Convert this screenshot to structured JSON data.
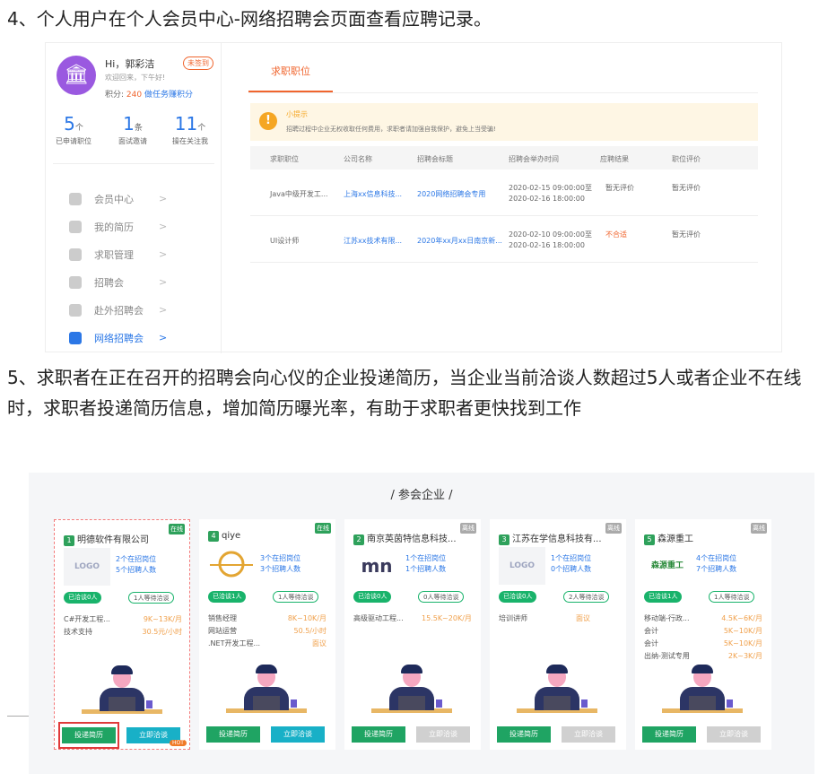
{
  "step4_text": "4、个人用户在个人会员中心-网络招聘会页面查看应聘记录。",
  "step5_text": "5、求职者在正在召开的招聘会向心仪的企业投递简历，当企业当前洽谈人数超过5人或者企业不在线时，求职者投递简历信息，增加简历曝光率，有助于求职者更快找到工作",
  "member": {
    "greeting": "Hi，郭彩洁",
    "sign_label": "未签到",
    "welcome": "欢迎回来，下午好!",
    "points_label": "积分:",
    "points_value": "240",
    "earn_link": "做任务赚积分",
    "stats": [
      {
        "num": "5",
        "unit": "个",
        "label": "已申请职位"
      },
      {
        "num": "1",
        "unit": "条",
        "label": "面试邀请"
      },
      {
        "num": "11",
        "unit": "个",
        "label": "操在关注我"
      }
    ],
    "menu": [
      {
        "label": "会员中心",
        "active": false
      },
      {
        "label": "我的简历",
        "active": false
      },
      {
        "label": "求职管理",
        "active": false
      },
      {
        "label": "招聘会",
        "active": false
      },
      {
        "label": "赴外招聘会",
        "active": false
      },
      {
        "label": "网络招聘会",
        "active": true
      }
    ]
  },
  "tab_label": "求职职位",
  "tip": {
    "title": "小提示",
    "text": "招聘过程中企业无权收取任何费用，求职者请加强自我保护，避免上当受骗!"
  },
  "table": {
    "headers": [
      "求职职位",
      "公司名称",
      "招聘会标题",
      "招聘会举办时间",
      "应聘结果",
      "职位评价"
    ],
    "rows": [
      {
        "position": "Java中级开发工...",
        "company": "上海xx信息科技...",
        "fair": "2020网络招聘会专用",
        "time1": "2020-02-15 09:00:00至",
        "time2": "2020-02-16 18:00:00",
        "result": "暂无评价",
        "review": "暂无评价"
      },
      {
        "position": "UI设计师",
        "company": "江苏xx技术有限...",
        "fair": "2020年xx月xx日南京新...",
        "time1": "2020-02-10 09:00:00至",
        "time2": "2020-02-16 18:00:00",
        "result": "不合适",
        "review": "暂无评价"
      }
    ]
  },
  "panel_title": "/ 参会企业 /",
  "companies": [
    {
      "num": "1",
      "name": "明德软件有限公司",
      "badge": "在线",
      "logo": "LOGO",
      "positions": "2个在招岗位",
      "recruits": "5个招聘人数",
      "talking": "已洽谈0人",
      "waiting": "1人等待洽谈",
      "jobs": [
        {
          "t": "C#开发工程...",
          "s": "9K~13K/月"
        },
        {
          "t": "技术支持",
          "s": "30.5元/小时"
        }
      ],
      "btn_apply": "投递简历",
      "btn_chat": "立即洽谈",
      "hot": "HOT"
    },
    {
      "num": "4",
      "name": "qiye",
      "badge": "在线",
      "logo": "",
      "positions": "3个在招岗位",
      "recruits": "3个招聘人数",
      "talking": "已洽谈1人",
      "waiting": "1人等待洽谈",
      "jobs": [
        {
          "t": "销售经理",
          "s": "8K~10K/月"
        },
        {
          "t": "网站运营",
          "s": "50.5/小时"
        },
        {
          "t": ".NET开发工程...",
          "s": "面议"
        }
      ],
      "btn_apply": "投递简历",
      "btn_chat": "立即洽谈"
    },
    {
      "num": "2",
      "name": "南京英茵特信息科技...",
      "badge": "离线",
      "logo": "mn",
      "positions": "1个在招岗位",
      "recruits": "1个招聘人数",
      "talking": "已洽谈0人",
      "waiting": "0人等待洽谈",
      "jobs": [
        {
          "t": "高级驱动工程...",
          "s": "15.5K~20K/月"
        }
      ],
      "btn_apply": "投递简历",
      "btn_chat": "立即洽谈"
    },
    {
      "num": "3",
      "name": "江苏在学信息科技有...",
      "badge": "离线",
      "logo": "LOGO",
      "positions": "1个在招岗位",
      "recruits": "0个招聘人数",
      "talking": "已洽谈0人",
      "waiting": "2人等待洽谈",
      "jobs": [
        {
          "t": "培训讲师",
          "s": "面议"
        }
      ],
      "btn_apply": "投递简历",
      "btn_chat": "立即洽谈"
    },
    {
      "num": "5",
      "name": "森源重工",
      "badge": "离线",
      "logo": "森源重工",
      "positions": "4个在招岗位",
      "recruits": "7个招聘人数",
      "talking": "已洽谈1人",
      "waiting": "1人等待洽谈",
      "jobs": [
        {
          "t": "移动端-行政...",
          "s": "4.5K~6K/月"
        },
        {
          "t": "会计",
          "s": "5K~10K/月"
        },
        {
          "t": "会计",
          "s": "5K~10K/月"
        },
        {
          "t": "出纳-测试专用",
          "s": "2K~3K/月"
        }
      ],
      "btn_apply": "投递简历",
      "btn_chat": "立即洽谈"
    }
  ]
}
